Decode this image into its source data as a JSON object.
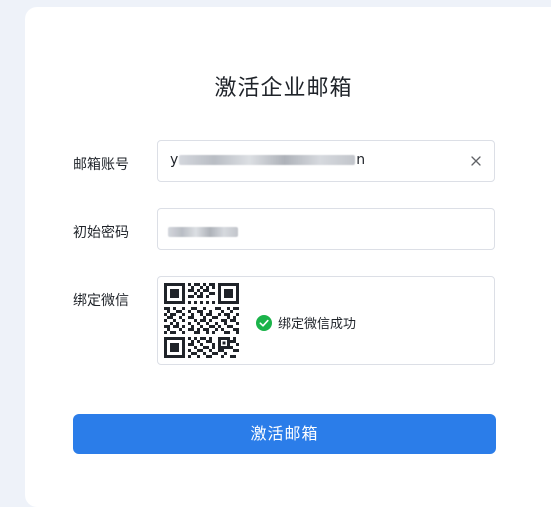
{
  "page": {
    "title": "激活企业邮箱"
  },
  "form": {
    "email": {
      "label": "邮箱账号",
      "value_prefix": "y",
      "value_suffix": "n"
    },
    "password": {
      "label": "初始密码"
    },
    "wechat": {
      "label": "绑定微信",
      "status_text": "绑定微信成功"
    },
    "submit_label": "激活邮箱"
  },
  "colors": {
    "primary": "#2b7de9",
    "success": "#1bb34a",
    "background": "#eef2f9"
  },
  "icons": {
    "clear": "close-icon",
    "success": "check-circle-icon",
    "qr": "qr-code"
  }
}
